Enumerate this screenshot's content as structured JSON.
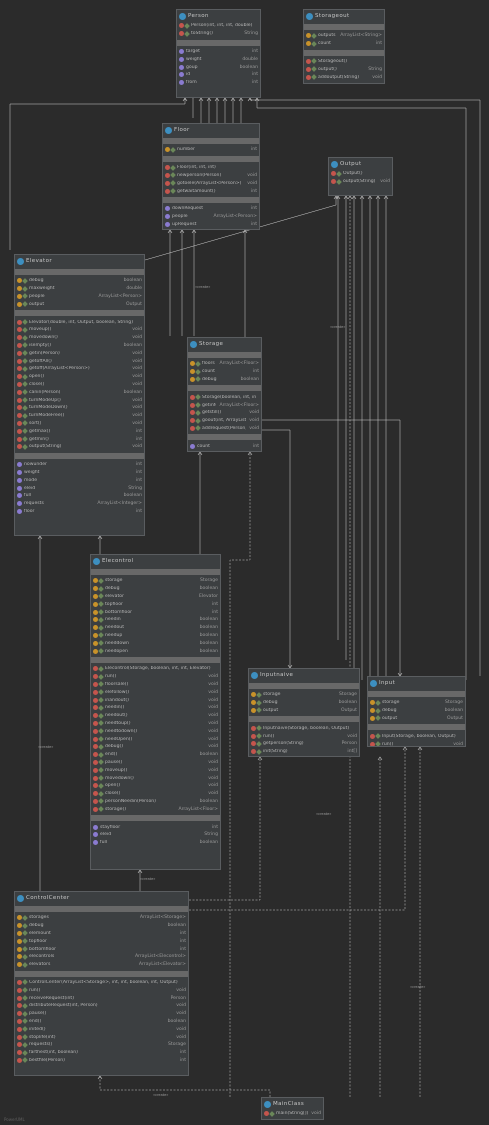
{
  "footer": {
    "watermark": "PowerUML"
  },
  "link_label": "«create»",
  "colors": {
    "background": "#2b2b2b",
    "node": "#3c3f41",
    "separator": "#686868",
    "edge": "#d0d0d0",
    "class_icon": "#3d8fc0",
    "field_icon": "#c8922a",
    "method_icon": "#c4554d",
    "property_icon": "#8a7bd0"
  },
  "classes": {
    "person": {
      "name": "Person",
      "fields": [],
      "methods": [
        {
          "label": "Person(int, int, int, double)",
          "type": ""
        },
        {
          "label": "toString()",
          "type": "String"
        }
      ],
      "properties": [
        {
          "label": "target",
          "type": "int"
        },
        {
          "label": "weight",
          "type": "double"
        },
        {
          "label": "goup",
          "type": "boolean"
        },
        {
          "label": "id",
          "type": "int"
        },
        {
          "label": "from",
          "type": "int"
        }
      ]
    },
    "storageout": {
      "name": "Storageout",
      "fields": [
        {
          "label": "outputs",
          "type": "ArrayList<String>"
        },
        {
          "label": "count",
          "type": "int"
        }
      ],
      "methods": [
        {
          "label": "Storageout()",
          "type": ""
        },
        {
          "label": "output()",
          "type": "String"
        },
        {
          "label": "addoutput(String)",
          "type": "void"
        }
      ],
      "properties": []
    },
    "floor": {
      "name": "Floor",
      "fields": [
        {
          "label": "number",
          "type": "int"
        }
      ],
      "methods": [
        {
          "label": "Floor(int, int, int)",
          "type": ""
        },
        {
          "label": "newperson(Person)",
          "type": "void"
        },
        {
          "label": "gotoele(ArrayList<Person>)",
          "type": "void"
        },
        {
          "label": "getwaitamount()",
          "type": "int"
        }
      ],
      "properties": [
        {
          "label": "downRequest",
          "type": "int"
        },
        {
          "label": "people",
          "type": "ArrayList<Person>"
        },
        {
          "label": "upRequest",
          "type": "int"
        }
      ]
    },
    "output": {
      "name": "Output",
      "fields": [],
      "methods": [
        {
          "label": "Output()",
          "type": ""
        },
        {
          "label": "output(String)",
          "type": "void"
        }
      ],
      "properties": []
    },
    "elevator": {
      "name": "Elevator",
      "fields": [
        {
          "label": "debug",
          "type": "boolean"
        },
        {
          "label": "maxweight",
          "type": "double"
        },
        {
          "label": "people",
          "type": "ArrayList<Person>"
        },
        {
          "label": "output",
          "type": "Output"
        }
      ],
      "methods": [
        {
          "label": "Elevator(double, int, Output, boolean, String)",
          "type": ""
        },
        {
          "label": "moveup()",
          "type": "void"
        },
        {
          "label": "movedown()",
          "type": "void"
        },
        {
          "label": "isempty()",
          "type": "boolean"
        },
        {
          "label": "getin(Person)",
          "type": "void"
        },
        {
          "label": "getoffAll()",
          "type": "void"
        },
        {
          "label": "getoff(ArrayList<Person>)",
          "type": "void"
        },
        {
          "label": "open()",
          "type": "void"
        },
        {
          "label": "close()",
          "type": "void"
        },
        {
          "label": "canin(Person)",
          "type": "boolean"
        },
        {
          "label": "turnModeUp()",
          "type": "void"
        },
        {
          "label": "turnModeDown()",
          "type": "void"
        },
        {
          "label": "turnModeFree()",
          "type": "void"
        },
        {
          "label": "sort()",
          "type": "void"
        },
        {
          "label": "getmax()",
          "type": "int"
        },
        {
          "label": "getmin()",
          "type": "int"
        },
        {
          "label": "output(String)",
          "type": "void"
        }
      ],
      "properties": [
        {
          "label": "nowunder",
          "type": "int"
        },
        {
          "label": "weight",
          "type": "int"
        },
        {
          "label": "mode",
          "type": "int"
        },
        {
          "label": "eleid",
          "type": "String"
        },
        {
          "label": "full",
          "type": "boolean"
        },
        {
          "label": "requests",
          "type": "ArrayList<Integer>"
        },
        {
          "label": "floor",
          "type": "int"
        }
      ]
    },
    "storage": {
      "name": "Storage",
      "fields": [
        {
          "label": "floors",
          "type": "ArrayList<Floor>"
        },
        {
          "label": "count",
          "type": "int"
        },
        {
          "label": "debug",
          "type": "boolean"
        }
      ],
      "methods": [
        {
          "label": "Storage(boolean, int, int)",
          "type": ""
        },
        {
          "label": "getinfo()",
          "type": "ArrayList<Floor>"
        },
        {
          "label": "getstill()",
          "type": "void"
        },
        {
          "label": "goout(int, ArrayList<Person>)",
          "type": "void"
        },
        {
          "label": "addrequest(Person, boolean)",
          "type": "void"
        }
      ],
      "properties": [
        {
          "label": "count",
          "type": "int"
        }
      ]
    },
    "elecontrol": {
      "name": "Elecontrol",
      "fields": [
        {
          "label": "storage",
          "type": "Storage"
        },
        {
          "label": "debug",
          "type": "boolean"
        },
        {
          "label": "elevator",
          "type": "Elevator"
        },
        {
          "label": "topfloor",
          "type": "int"
        },
        {
          "label": "bottomfloor",
          "type": "int"
        },
        {
          "label": "needin",
          "type": "boolean"
        },
        {
          "label": "needout",
          "type": "boolean"
        },
        {
          "label": "needup",
          "type": "boolean"
        },
        {
          "label": "needdown",
          "type": "boolean"
        },
        {
          "label": "needopen",
          "type": "boolean"
        }
      ],
      "methods": [
        {
          "label": "Elecontrol(Storage, boolean, int, int, Elevator)",
          "type": ""
        },
        {
          "label": "run()",
          "type": "void"
        },
        {
          "label": "floorsale()",
          "type": "void"
        },
        {
          "label": "elefollow()",
          "type": "void"
        },
        {
          "label": "inandout()",
          "type": "void"
        },
        {
          "label": "needin()",
          "type": "void"
        },
        {
          "label": "needout()",
          "type": "void"
        },
        {
          "label": "needtoup()",
          "type": "void"
        },
        {
          "label": "needtodown()",
          "type": "void"
        },
        {
          "label": "needOpen()",
          "type": "void"
        },
        {
          "label": "debug()",
          "type": "void"
        },
        {
          "label": "end()",
          "type": "boolean"
        },
        {
          "label": "pause()",
          "type": "void"
        },
        {
          "label": "moveup()",
          "type": "void"
        },
        {
          "label": "movedown()",
          "type": "void"
        },
        {
          "label": "open()",
          "type": "void"
        },
        {
          "label": "close()",
          "type": "void"
        },
        {
          "label": "personNeedin(Person)",
          "type": "boolean"
        },
        {
          "label": "storage()",
          "type": "ArrayList<Floor>"
        }
      ],
      "properties": [
        {
          "label": "stayfloor",
          "type": "int"
        },
        {
          "label": "eleid",
          "type": "String"
        },
        {
          "label": "full",
          "type": "boolean"
        }
      ]
    },
    "inputnaive": {
      "name": "Inputnaive",
      "fields": [
        {
          "label": "storage",
          "type": "Storage"
        },
        {
          "label": "debug",
          "type": "boolean"
        },
        {
          "label": "output",
          "type": "Output"
        }
      ],
      "methods": [
        {
          "label": "Inputnaive(Storage, boolean, Output)",
          "type": ""
        },
        {
          "label": "run()",
          "type": "void"
        },
        {
          "label": "getperson(String)",
          "type": "Person"
        },
        {
          "label": "init(String)",
          "type": "int[]"
        }
      ],
      "properties": []
    },
    "input": {
      "name": "Input",
      "fields": [
        {
          "label": "storage",
          "type": "Storage"
        },
        {
          "label": "debug",
          "type": "boolean"
        },
        {
          "label": "output",
          "type": "Output"
        }
      ],
      "methods": [
        {
          "label": "Input(Storage, boolean, Output)",
          "type": ""
        },
        {
          "label": "run()",
          "type": "void"
        }
      ],
      "properties": []
    },
    "controlcenter": {
      "name": "ControlCenter",
      "fields": [
        {
          "label": "storages",
          "type": "ArrayList<Storage>"
        },
        {
          "label": "debug",
          "type": "boolean"
        },
        {
          "label": "elemount",
          "type": "int"
        },
        {
          "label": "topfloor",
          "type": "int"
        },
        {
          "label": "bottomfloor",
          "type": "int"
        },
        {
          "label": "elecontrols",
          "type": "ArrayList<Elecontrol>"
        },
        {
          "label": "elevators",
          "type": "ArrayList<Elevator>"
        }
      ],
      "methods": [
        {
          "label": "ControlCenter(ArrayList<Storage>, int, int, boolean, int, Output)",
          "type": ""
        },
        {
          "label": "run()",
          "type": "void"
        },
        {
          "label": "receiveRequest(int)",
          "type": "Person"
        },
        {
          "label": "distributeRequest(int, Person)",
          "type": "void"
        },
        {
          "label": "pause()",
          "type": "void"
        },
        {
          "label": "end()",
          "type": "boolean"
        },
        {
          "label": "inited()",
          "type": "void"
        },
        {
          "label": "stoplife(int)",
          "type": "void"
        },
        {
          "label": "requests()",
          "type": "Storage"
        },
        {
          "label": "farthest(int, boolean)",
          "type": "int"
        },
        {
          "label": "bestfile(Person)",
          "type": "int"
        }
      ],
      "properties": []
    },
    "mainclass": {
      "name": "MainClass",
      "fields": [],
      "methods": [
        {
          "label": "main(String[])",
          "type": "void"
        }
      ],
      "properties": []
    }
  }
}
